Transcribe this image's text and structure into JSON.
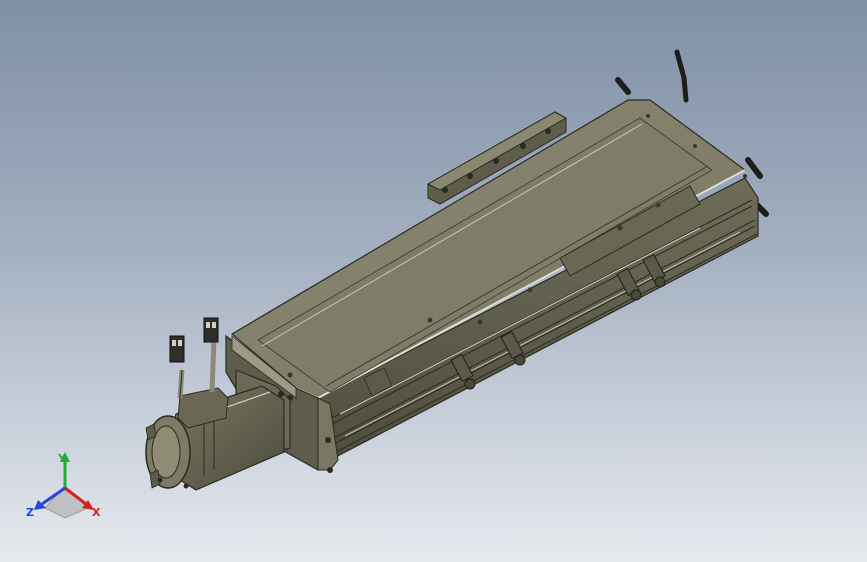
{
  "viewport": {
    "background_top": "#7f8fa6",
    "background_bottom": "#e6e9ee"
  },
  "model": {
    "body_color": "#6d6b58",
    "body_light": "#8a8870",
    "body_dark": "#4a4939",
    "edge_color": "#2a2a22",
    "highlight": "#d9d9cf"
  },
  "triad": {
    "y_label": "Y",
    "x_label": "X",
    "z_label": "Z",
    "y_color": "#1fae3a",
    "x_color": "#d42222",
    "z_color": "#2646d6"
  }
}
